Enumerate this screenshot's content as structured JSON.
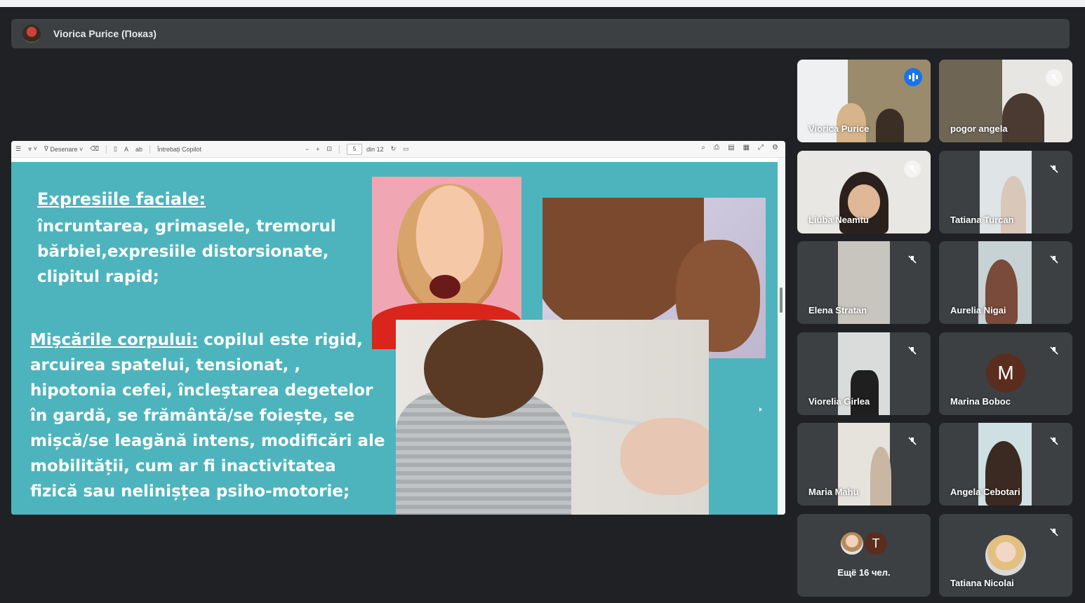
{
  "presenter": {
    "name": "Viorica Purice (Показ)"
  },
  "viewer_toolbar": {
    "draw_label": "Desenare",
    "copilot_label": "Întrebați Copilot",
    "page_current": "5",
    "page_total": "din 12"
  },
  "slide": {
    "heading1": "Expresiile faciale:",
    "text1": "încruntarea, grimasele, tremorul bărbiei,expresiile distorsionate, clipitul rapid;",
    "heading2": "Mişcările corpului:",
    "text2": " copilul este rigid, arcuirea spatelui, tensionat, , hipotonia cefei, încleştarea degetelor în gardă, se frământă/se foiește, se mișcă/se leagănă intens, modificări ale mobilității, cum ar fi inactivitatea fizică sau nelinișțea psiho-motorie;"
  },
  "participants": [
    {
      "name": "Viorica Purice",
      "muted": false,
      "speaking": true
    },
    {
      "name": "pogor angela",
      "muted": true
    },
    {
      "name": "Liuba Neamtu",
      "muted": true
    },
    {
      "name": "Tatiana Turcan",
      "muted": true
    },
    {
      "name": "Elena Stratan",
      "muted": true
    },
    {
      "name": "Aurelia Nigai",
      "muted": true
    },
    {
      "name": "Viorelia Girlea",
      "muted": true
    },
    {
      "name": "Marina Boboc",
      "muted": true,
      "avatar_letter": "M"
    },
    {
      "name": "Maria Mahu",
      "muted": true
    },
    {
      "name": "Angela Cebotari",
      "muted": true
    },
    {
      "name": "Tatiana Nicolai",
      "muted": true
    }
  ],
  "more": {
    "avatar_letter": "T",
    "label": "Ещё 16 чел."
  },
  "colors": {
    "background": "#202124",
    "tile": "#3c4043",
    "active_outline": "#8ab4f8",
    "slide_bg": "#4db4bd"
  }
}
